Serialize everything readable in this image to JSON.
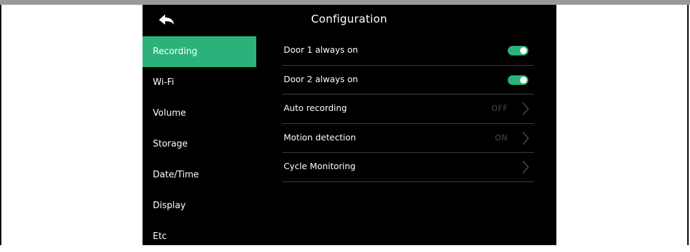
{
  "header": {
    "title": "Configuration"
  },
  "sidebar": {
    "items": [
      {
        "label": "Recording",
        "active": true
      },
      {
        "label": "Wi-Fi",
        "active": false
      },
      {
        "label": "Volume",
        "active": false
      },
      {
        "label": "Storage",
        "active": false
      },
      {
        "label": "Date/Time",
        "active": false
      },
      {
        "label": "Display",
        "active": false
      },
      {
        "label": "Etc",
        "active": false
      }
    ]
  },
  "settings": {
    "rows": [
      {
        "label": "Door 1 always on",
        "type": "toggle",
        "on": true
      },
      {
        "label": "Door 2 always on",
        "type": "toggle",
        "on": true
      },
      {
        "label": "Auto recording",
        "type": "select",
        "value": "OFF"
      },
      {
        "label": "Motion detection",
        "type": "select",
        "value": "ON"
      },
      {
        "label": "Cycle Monitoring",
        "type": "select",
        "value": ""
      }
    ]
  },
  "colors": {
    "accent": "#2bb17a",
    "background": "#000000",
    "divider": "#3f3f3f",
    "muted_value": "#4a4a4a"
  },
  "icons": {
    "back": "back-arrow-icon",
    "chevron": "chevron-right-icon"
  }
}
